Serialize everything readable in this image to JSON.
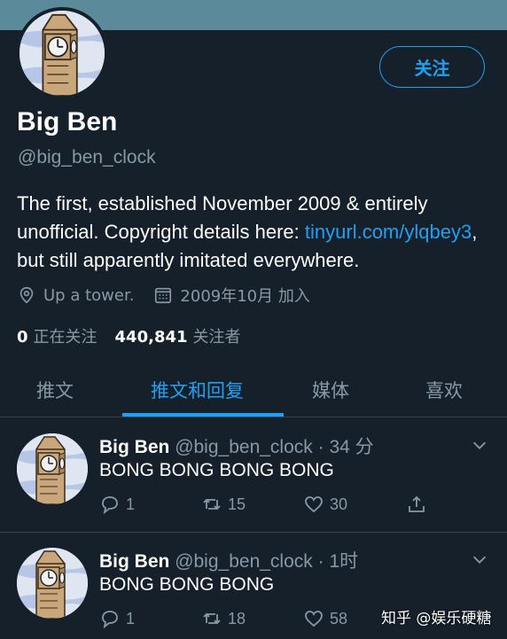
{
  "profile": {
    "name": "Big Ben",
    "handle": "@big_ben_clock",
    "follow_label": "关注",
    "bio_text_1": "The first, established November 2009 & entirely unofficial. Copyright details here: ",
    "bio_link": "tinyurl.com/ylqbey3",
    "bio_text_2": ", but still apparently imitated everywhere.",
    "location": "Up a tower.",
    "joined": "2009年10月 加入",
    "following_count": "0",
    "following_label": "正在关注",
    "followers_count": "440,841",
    "followers_label": "关注者"
  },
  "tabs": [
    {
      "label": "推文",
      "active": false
    },
    {
      "label": "推文和回复",
      "active": true
    },
    {
      "label": "媒体",
      "active": false
    },
    {
      "label": "喜欢",
      "active": false
    }
  ],
  "tweets": [
    {
      "name": "Big Ben",
      "handle": "@big_ben_clock",
      "time": "· 34 分",
      "text": "BONG BONG BONG BONG",
      "replies": "1",
      "retweets": "15",
      "likes": "30"
    },
    {
      "name": "Big Ben",
      "handle": "@big_ben_clock",
      "time": "· 1时",
      "text": "BONG BONG BONG",
      "replies": "1",
      "retweets": "18",
      "likes": "58"
    }
  ],
  "watermark": "知乎 @娱乐硬糖",
  "colors": {
    "background": "#15202b",
    "accent": "#1da1f2",
    "muted": "#8899a6",
    "divider": "#38444d"
  },
  "icons": {
    "location": "location-pin-icon",
    "calendar": "calendar-icon",
    "reply": "reply-icon",
    "retweet": "retweet-icon",
    "like": "heart-icon",
    "share": "share-icon",
    "more": "chevron-down-icon"
  }
}
